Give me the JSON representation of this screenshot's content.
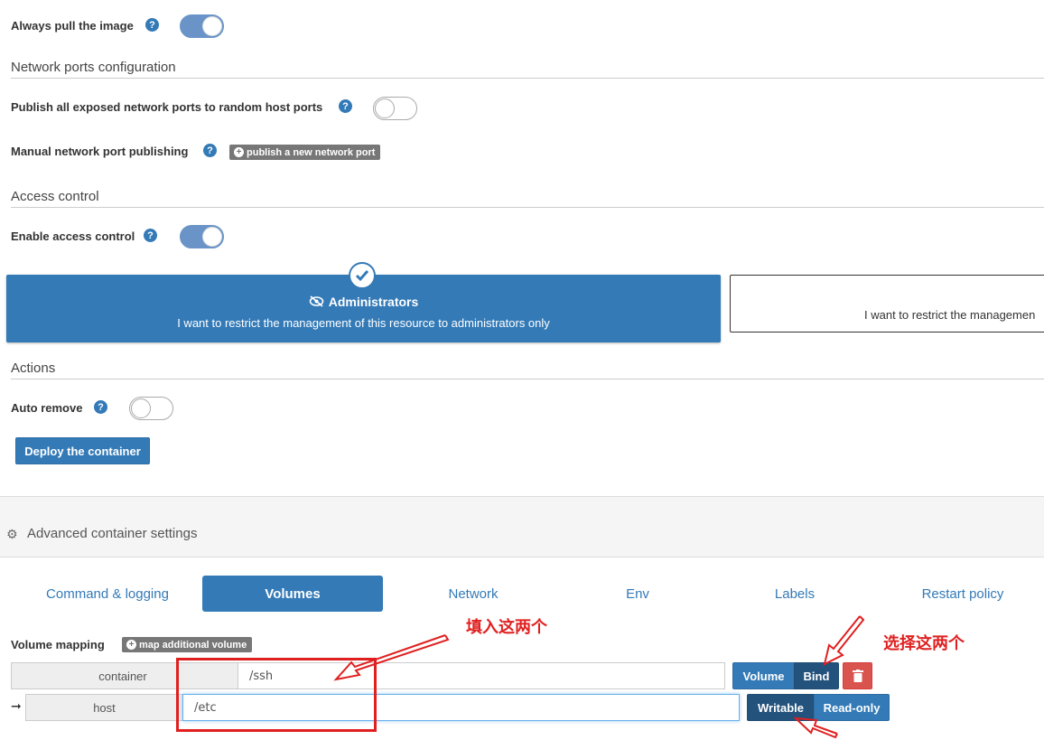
{
  "always_pull": {
    "label": "Always pull the image",
    "help_icon": "question-circle-icon",
    "enabled": true
  },
  "network_ports": {
    "section_title": "Network ports configuration",
    "publish_all_label": "Publish all exposed network ports to random host ports",
    "publish_all_enabled": false,
    "manual_label": "Manual network port publishing",
    "publish_new_button": "publish a new network port"
  },
  "access_control": {
    "section_title": "Access control",
    "enable_label": "Enable access control",
    "enabled": true,
    "admin_option": {
      "title": "Administrators",
      "description": "I want to restrict the management of this resource to administrators only",
      "selected": true,
      "icon": "eye-slash-icon"
    },
    "restricted_option": {
      "description_partial": "I want to restrict the managemen"
    }
  },
  "actions": {
    "section_title": "Actions",
    "auto_remove_label": "Auto remove",
    "auto_remove_enabled": false,
    "deploy_button": "Deploy the container"
  },
  "advanced": {
    "header": "Advanced container settings",
    "header_icon": "gear-icon",
    "tabs": [
      {
        "label": "Command & logging",
        "active": false
      },
      {
        "label": "Volumes",
        "active": true
      },
      {
        "label": "Network",
        "active": false
      },
      {
        "label": "Env",
        "active": false
      },
      {
        "label": "Labels",
        "active": false
      },
      {
        "label": "Restart policy",
        "active": false
      }
    ]
  },
  "volumes": {
    "mapping_label": "Volume mapping",
    "map_additional_button": "map additional volume",
    "container_addon": "container",
    "container_value": "/ssh",
    "type_volume": "Volume",
    "type_bind": "Bind",
    "type_selected": "Bind",
    "host_addon": "host",
    "host_value": "/etc",
    "mode_writable": "Writable",
    "mode_readonly": "Read-only",
    "mode_selected": "Writable"
  },
  "annotations": {
    "fill_these_two": "填入这两个",
    "select_these_two": "选择这两个",
    "accent_color": "#e02020"
  }
}
